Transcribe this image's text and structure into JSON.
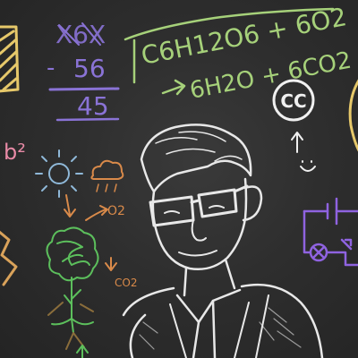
{
  "math": {
    "top_number": "X6X",
    "minus": "-",
    "subtrahend": "56",
    "result": "45"
  },
  "formula": {
    "reactants": "C6H12O6 + 6O2",
    "products": "6H2O + 6CO2"
  },
  "badge": {
    "text": "CC"
  },
  "corner_note": "b²",
  "o2_label": "O2",
  "co2_label": "CO2",
  "colors": {
    "board": "#2e2e2e",
    "chalk_white": "#e8e8e8",
    "math_purple": "#8a73d6",
    "formula_green": "#a6d17a",
    "pink": "#e88aa6",
    "yellow": "#e6c86a",
    "orange": "#d98a4a",
    "diagram_purple": "#8f63e0",
    "plant_green": "#5cbf5c",
    "sun_blue": "#8fb8d8"
  }
}
